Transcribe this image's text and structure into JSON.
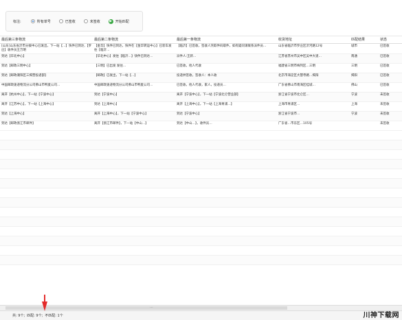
{
  "filter": {
    "label": "标注:",
    "options": [
      {
        "label": "所有单号",
        "checked": true
      },
      {
        "label": "已签收",
        "checked": false
      },
      {
        "label": "未签收",
        "checked": false
      }
    ],
    "start_label": "开始匹配"
  },
  "table": {
    "headers": [
      "最后第三条物流",
      "最后第二条物流",
      "最后第一条物流",
      "收货地址",
      "匹配结果",
      "状态"
    ],
    "rows": [
      [
        "[山东]山东省沂市分拨中心已发出，下一站【…】快件已到达,【罗庄】收件员王万明",
        "【金华】快件已到达，快件在【金华转运中心】已装车发往【临沂…",
        "【临沂】已签收，签收人凭取件码取件，如有疑问请联系派件员…",
        "山东省临沂市罗庄区沂河路12号",
        "城市",
        "已签收"
      ],
      [
        "到达【华北中心】",
        "【华北中心】发往【临沂…】快件已到达…",
        "派件人:王新…",
        "江苏省苏州市吴中区吴中大道…",
        "南通",
        "已签收"
      ],
      [
        "到达【邮政三明中心】",
        "【三明】已出发 发往…",
        "已签收，他人代收",
        "福建省三明市梅列区…三明",
        "三明",
        "已签收"
      ],
      [
        "到达【邮政潮阳区三揭营投递部】",
        "【邮政】已发出，下一站【…】",
        "投递并签收，签收人：本人收",
        "北京市海淀区大慧寺路…揭阳",
        "揭阳",
        "已签收"
      ],
      [
        "中国邮政速递物流分公司佛山市鸭麦公司…",
        "中国邮政速递物流分公司佛山市鸭麦公司…",
        "已签收，他人代收，家人，投递员…",
        "广东省佛山市南海区桂城…",
        "佛山",
        "已签收"
      ],
      [
        "离开【杭州中心】，下一站【宁波中心】",
        "到达【宁波中心】",
        "离开【宁波中心】，下一站【宁波北仑营业部】",
        "浙江省宁波市北仑区…",
        "宁波",
        "未签收"
      ],
      [
        "离开【江苏中心】，下一站【上海中心】",
        "到达【上海中心】",
        "离开【上海中心】，下一站【上海青浦…】",
        "上海市青浦区…",
        "上海",
        "未签收"
      ],
      [
        "到达【上海中心】",
        "离开【上海中心】，下一站【宁波中心】",
        "到达【宁波中心】",
        "浙江省宁波市…",
        "宁波",
        "未签收"
      ],
      [
        "到达【邮政浙江市邮件】",
        "离开【浙江市邮件】，下一站【中山…】",
        "到达【中山…】，收件员…",
        "广东省…市东区…105号",
        "",
        "未签收"
      ]
    ],
    "empty_rows": 14
  },
  "status": {
    "total_label": "共: 9个;",
    "match_label": "匹配: 9个;",
    "nomatch_label": "不匹配: 1个"
  },
  "watermark": {
    "text": "川神下载网"
  }
}
